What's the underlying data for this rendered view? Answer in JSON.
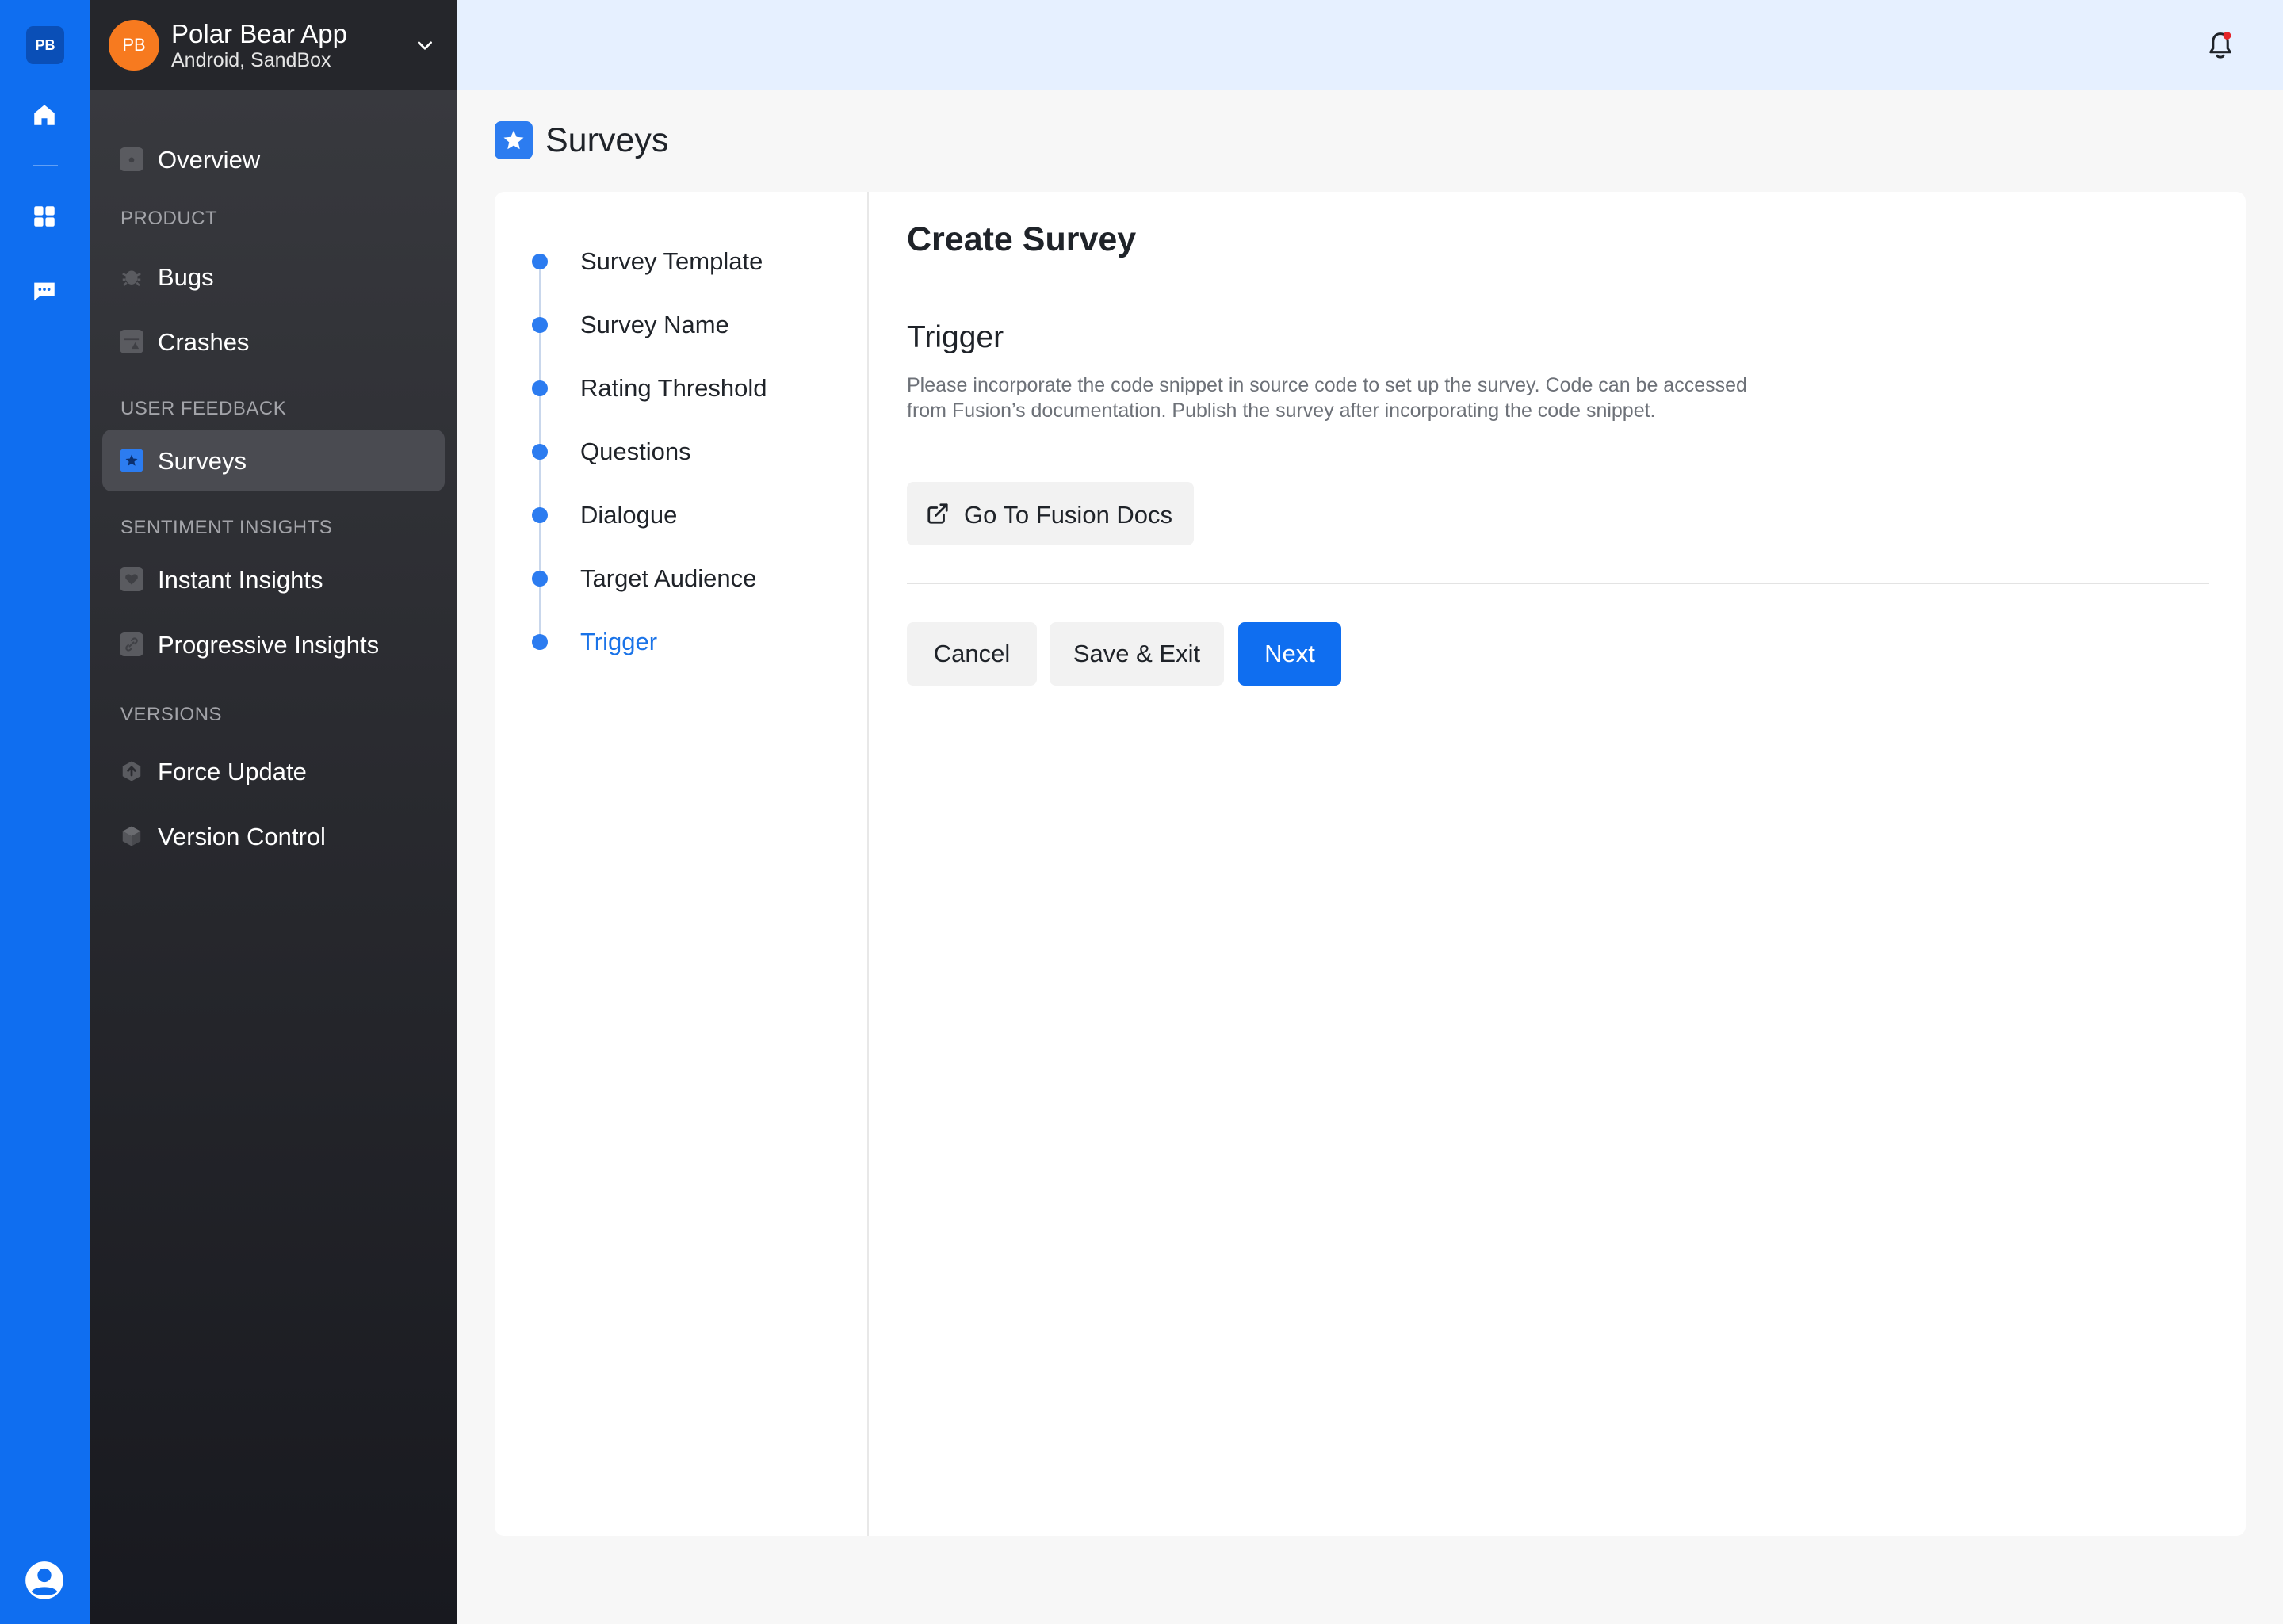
{
  "rail": {
    "logo": "PB",
    "icons": [
      "home-icon",
      "dashboard-grid-icon",
      "chat-icon",
      "user-account-icon"
    ]
  },
  "app": {
    "avatar": "PB",
    "name": "Polar Bear App",
    "subtitle": "Android, SandBox"
  },
  "sidebar": {
    "overview": "Overview",
    "sections": {
      "product": "PRODUCT",
      "user_feedback": "USER FEEDBACK",
      "sentiment_insights": "SENTIMENT INSIGHTS",
      "versions": "VERSIONS"
    },
    "items": {
      "bugs": "Bugs",
      "crashes": "Crashes",
      "surveys": "Surveys",
      "instant_insights": "Instant Insights",
      "progressive_insights": "Progressive Insights",
      "force_update": "Force Update",
      "version_control": "Version Control"
    },
    "active": "Surveys"
  },
  "page": {
    "title": "Surveys"
  },
  "steps": [
    {
      "label": "Survey Template"
    },
    {
      "label": "Survey Name"
    },
    {
      "label": "Rating Threshold"
    },
    {
      "label": "Questions"
    },
    {
      "label": "Dialogue"
    },
    {
      "label": "Target Audience"
    },
    {
      "label": "Trigger"
    }
  ],
  "current_step": "Trigger",
  "form": {
    "title": "Create Survey",
    "section_title": "Trigger",
    "description": "Please incorporate the code snippet in source code to set up the survey. Code can be accessed from Fusion’s documentation. Publish the survey after incorporating the code snippet.",
    "docs_button": "Go To Fusion Docs",
    "cancel": "Cancel",
    "save_exit": "Save & Exit",
    "next": "Next"
  },
  "colors": {
    "primary": "#0f6ef0",
    "accent_blue": "#2c7cf0",
    "avatar_orange": "#f77a1f",
    "notification_red": "#e5252a"
  }
}
